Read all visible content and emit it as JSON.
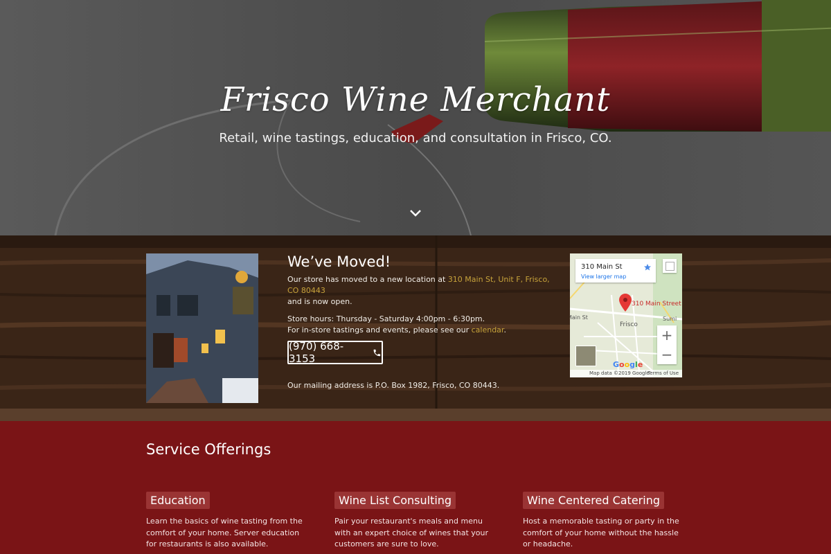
{
  "hero": {
    "title": "Frisco Wine Merchant",
    "tagline": "Retail, wine tastings, education, and consultation in Frisco, CO.",
    "scroll_icon": "chevron-down-icon"
  },
  "moved": {
    "heading": "We’ve Moved!",
    "p1_prefix": "Our store has moved to a new location at ",
    "p1_link": "310 Main St, Unit F, Frisco, CO 80443",
    "p1_suffix": "and is now open.",
    "hours": "Store hours:  Thursday - Saturday 4:00pm - 6:30pm.",
    "events_prefix": "For in-store tastings and events, please see our ",
    "events_link": "calendar",
    "events_suffix": ".",
    "phone": "(970) 668-3153",
    "phone_icon": "phone-icon",
    "mailing": "Our mailing address is P.O. Box 1982, Frisco, CO 80443."
  },
  "map": {
    "address": "310 Main St",
    "view_larger": "View larger map",
    "pin_label": "310 Main Street",
    "town_label": "Frisco",
    "street_label": "Main St",
    "side_label": "Sumi",
    "zoom_in": "+",
    "zoom_out": "−",
    "google": "Google",
    "map_data": "Map data ©2019 Google",
    "terms": "Terms of Use"
  },
  "services": {
    "heading": "Service Offerings",
    "items": [
      {
        "title": "Education",
        "text": "Learn the basics of wine tasting from the comfort of your home. Server education for restaurants is also available."
      },
      {
        "title": "Wine List Consulting",
        "text": "Pair your restaurant's meals and menu with an expert choice of wines that your customers are sure to love."
      },
      {
        "title": "Wine Centered Catering",
        "text": "Host a memorable tasting or party in the comfort of your home without the hassle or headache."
      }
    ]
  },
  "colors": {
    "accent_link": "#c7a33b",
    "burgundy": "#7a1416",
    "tag_bg": "#9a3434",
    "wood": "#3b2617"
  }
}
